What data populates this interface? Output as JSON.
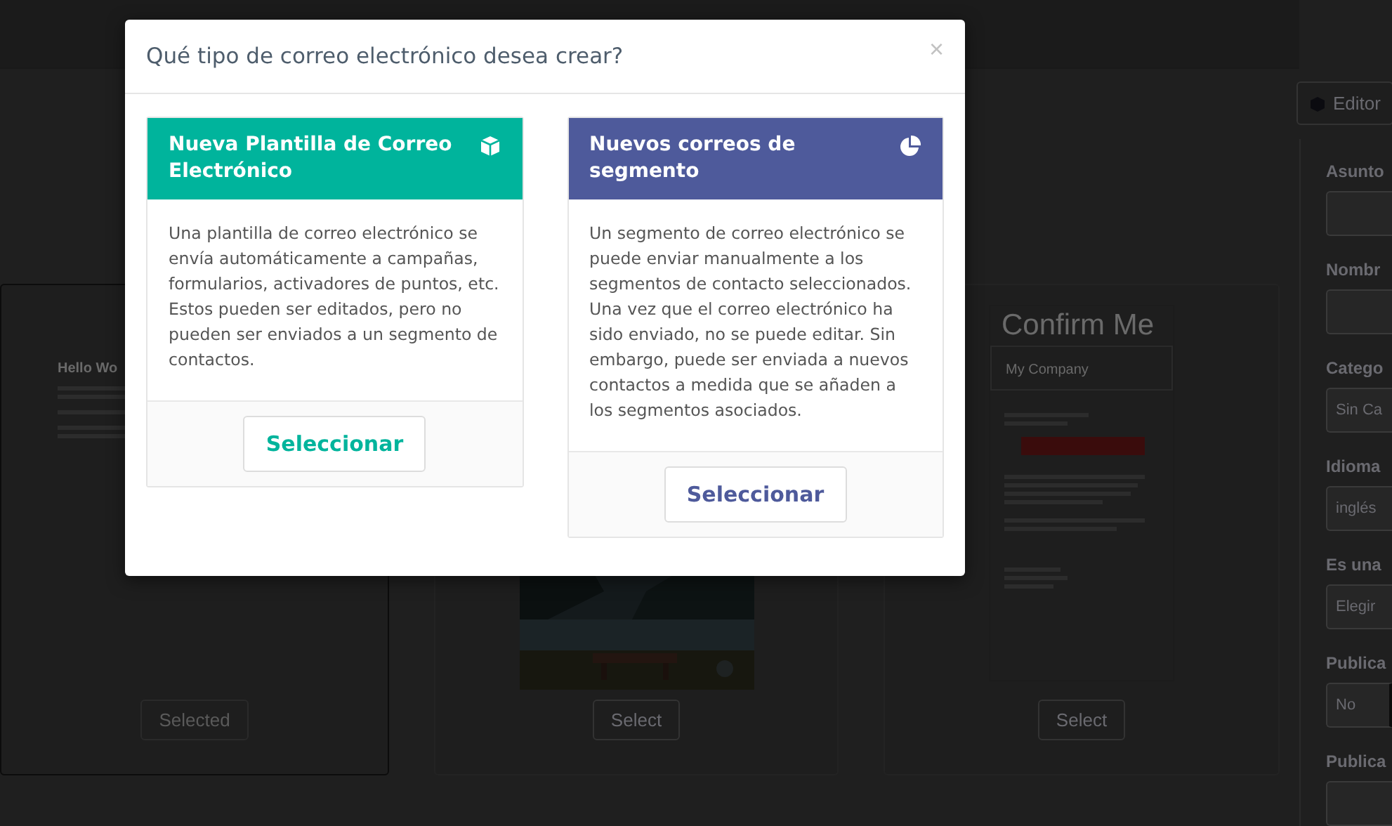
{
  "background": {
    "editor_button": "Editor",
    "templates": [
      {
        "kind": "document",
        "heading": "Hello Wo",
        "button": "Selected",
        "selected": true
      },
      {
        "button": "Select",
        "selected": false
      },
      {
        "kind": "confirm",
        "heading": "Confirm Me",
        "company": "My Company",
        "button": "Select",
        "selected": false
      }
    ],
    "form": [
      {
        "kind": "input",
        "label": "Asunto"
      },
      {
        "kind": "input",
        "label": "Nombr"
      },
      {
        "kind": "select",
        "label": "Catego",
        "value": "Sin Ca"
      },
      {
        "kind": "select",
        "label": "Idioma",
        "value": "inglés"
      },
      {
        "kind": "select",
        "label": "Es una",
        "value": "Elegir"
      },
      {
        "kind": "toggle",
        "label": "Publica",
        "value": "No",
        "on": false
      },
      {
        "kind": "input",
        "label": "Publica"
      }
    ]
  },
  "modal": {
    "title": "Qué tipo de correo electrónico desea crear?",
    "close": "×",
    "options": [
      {
        "kind": "template",
        "title": "Nueva Plantilla de Correo Electrónico",
        "color": "#00b49c",
        "description": "Una plantilla de correo electrónico se envía automáticamente a campañas, formularios, activadores de puntos, etc. Estos pueden ser editados, pero no pueden ser enviados a un segmento de contactos.",
        "button": "Seleccionar"
      },
      {
        "kind": "segment",
        "title": "Nuevos correos de segmento",
        "color": "#4e5a9b",
        "description": "Un segmento de correo electrónico se puede enviar manualmente a los segmentos de contacto seleccionados. Una vez que el correo electrónico ha sido enviado, no se puede editar. Sin embargo, puede ser enviada a nuevos contactos a medida que se añaden a los segmentos asociados.",
        "button": "Seleccionar"
      }
    ]
  }
}
